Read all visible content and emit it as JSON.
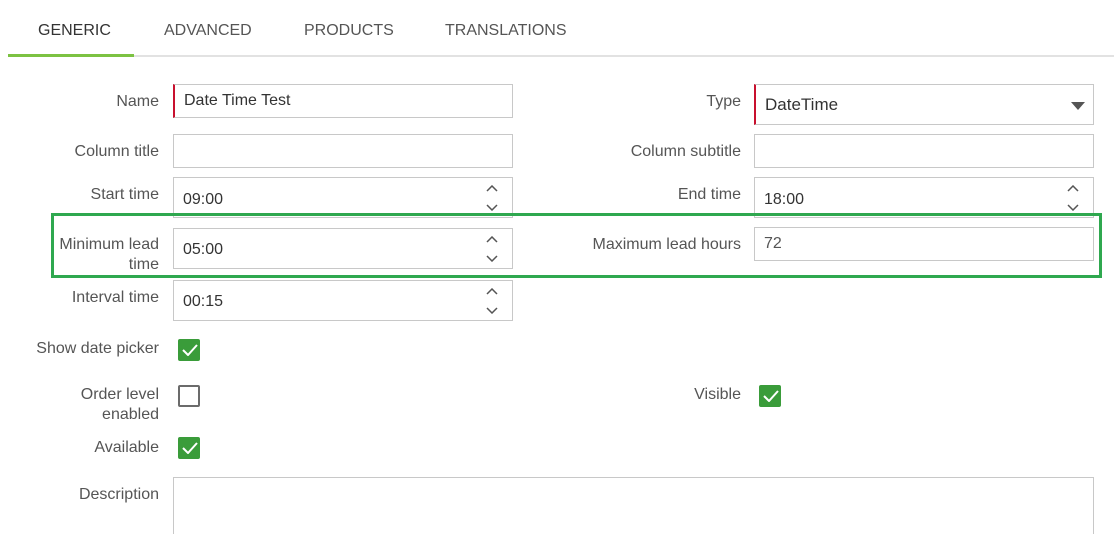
{
  "tabs": [
    {
      "label": "GENERIC",
      "active": true
    },
    {
      "label": "ADVANCED",
      "active": false
    },
    {
      "label": "PRODUCTS",
      "active": false
    },
    {
      "label": "TRANSLATIONS",
      "active": false
    }
  ],
  "form": {
    "name": {
      "label": "Name",
      "value": "Date Time Test"
    },
    "type": {
      "label": "Type",
      "value": "DateTime"
    },
    "column_title": {
      "label": "Column title",
      "value": ""
    },
    "column_subtitle": {
      "label": "Column subtitle",
      "value": ""
    },
    "start_time": {
      "label": "Start time",
      "value": "09:00"
    },
    "end_time": {
      "label": "End time",
      "value": "18:00"
    },
    "min_lead_time": {
      "label_line1": "Minimum lead",
      "label_line2": "time",
      "value": "05:00"
    },
    "max_lead_hours": {
      "label": "Maximum lead hours",
      "value": "72"
    },
    "interval_time": {
      "label": "Interval time",
      "value": "00:15"
    },
    "show_date_picker": {
      "label": "Show date picker",
      "checked": true
    },
    "order_level_enabled": {
      "label_line1": "Order level",
      "label_line2": "enabled",
      "checked": false
    },
    "visible": {
      "label": "Visible",
      "checked": true
    },
    "available": {
      "label": "Available",
      "checked": true
    },
    "description": {
      "label": "Description",
      "value": ""
    }
  },
  "colors": {
    "accent": "#7cc242",
    "checkbox": "#3a9c3a",
    "required": "#c8102e",
    "highlight": "#2fa84f"
  },
  "icons": [
    "spinner-up-icon",
    "spinner-down-icon",
    "dropdown-caret-icon",
    "checkmark-icon"
  ]
}
